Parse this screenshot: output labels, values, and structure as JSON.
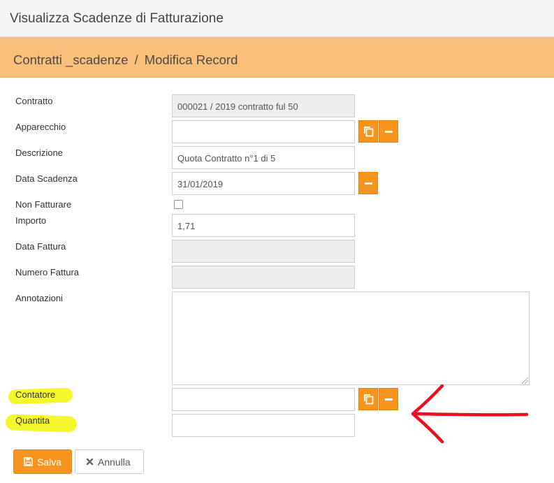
{
  "window": {
    "title": "Visualizza Scadenze di Fatturazione"
  },
  "breadcrumb": {
    "section": "Contratti _scadenze",
    "separator": "/",
    "page": "Modifica Record"
  },
  "form": {
    "contratto": {
      "label": "Contratto",
      "value": "000021 / 2019 contratto ful 50"
    },
    "apparecchio": {
      "label": "Apparecchio",
      "value": ""
    },
    "descrizione": {
      "label": "Descrizione",
      "value": "Quota Contratto n°1 di 5"
    },
    "data_scadenza": {
      "label": "Data Scadenza",
      "value": "31/01/2019"
    },
    "non_fatturare": {
      "label": "Non Fatturare",
      "checked": false
    },
    "importo": {
      "label": "Importo",
      "value": "1,71"
    },
    "data_fattura": {
      "label": "Data Fattura",
      "value": ""
    },
    "numero_fattura": {
      "label": "Numero Fattura",
      "value": ""
    },
    "annotazioni": {
      "label": "Annotazioni",
      "value": ""
    },
    "contatore": {
      "label": "Contatore",
      "value": ""
    },
    "quantita": {
      "label": "Quantita",
      "value": ""
    }
  },
  "buttons": {
    "save_label": "Salva",
    "cancel_label": "Annulla"
  },
  "icons": {
    "copy": "copy-icon",
    "minus": "minus-icon",
    "save": "floppy-disk-icon",
    "cancel": "close-icon"
  },
  "colors": {
    "accent": "#f7941d",
    "breadcrumb_bg": "#f9c07c",
    "highlight": "#f6f62c",
    "annotation_arrow": "#e8101f"
  }
}
